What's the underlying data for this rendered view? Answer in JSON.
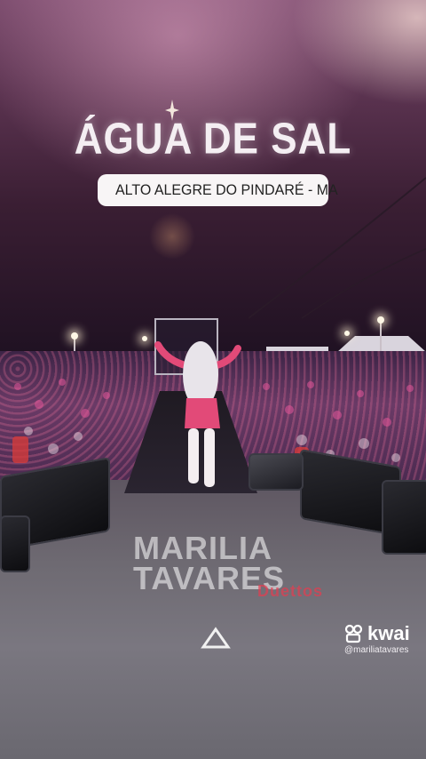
{
  "title": "ÁGUA DE SAL",
  "location": {
    "text": "ALTO ALEGRE DO PINDARÉ - MA",
    "icon": "map-pin-icon",
    "icon_color": "#e0337a"
  },
  "stage_floor": {
    "logo_line1": "MARILIA",
    "logo_line2": "TAVARES",
    "brand": "Duettos"
  },
  "watermark": {
    "app": "kwai",
    "handle": "@mariliatavares"
  },
  "colors": {
    "sky_top": "#7a4a6c",
    "sky_bottom": "#1c1020",
    "pill_bg": "#f8f5f6",
    "dress": "#e24a78"
  }
}
